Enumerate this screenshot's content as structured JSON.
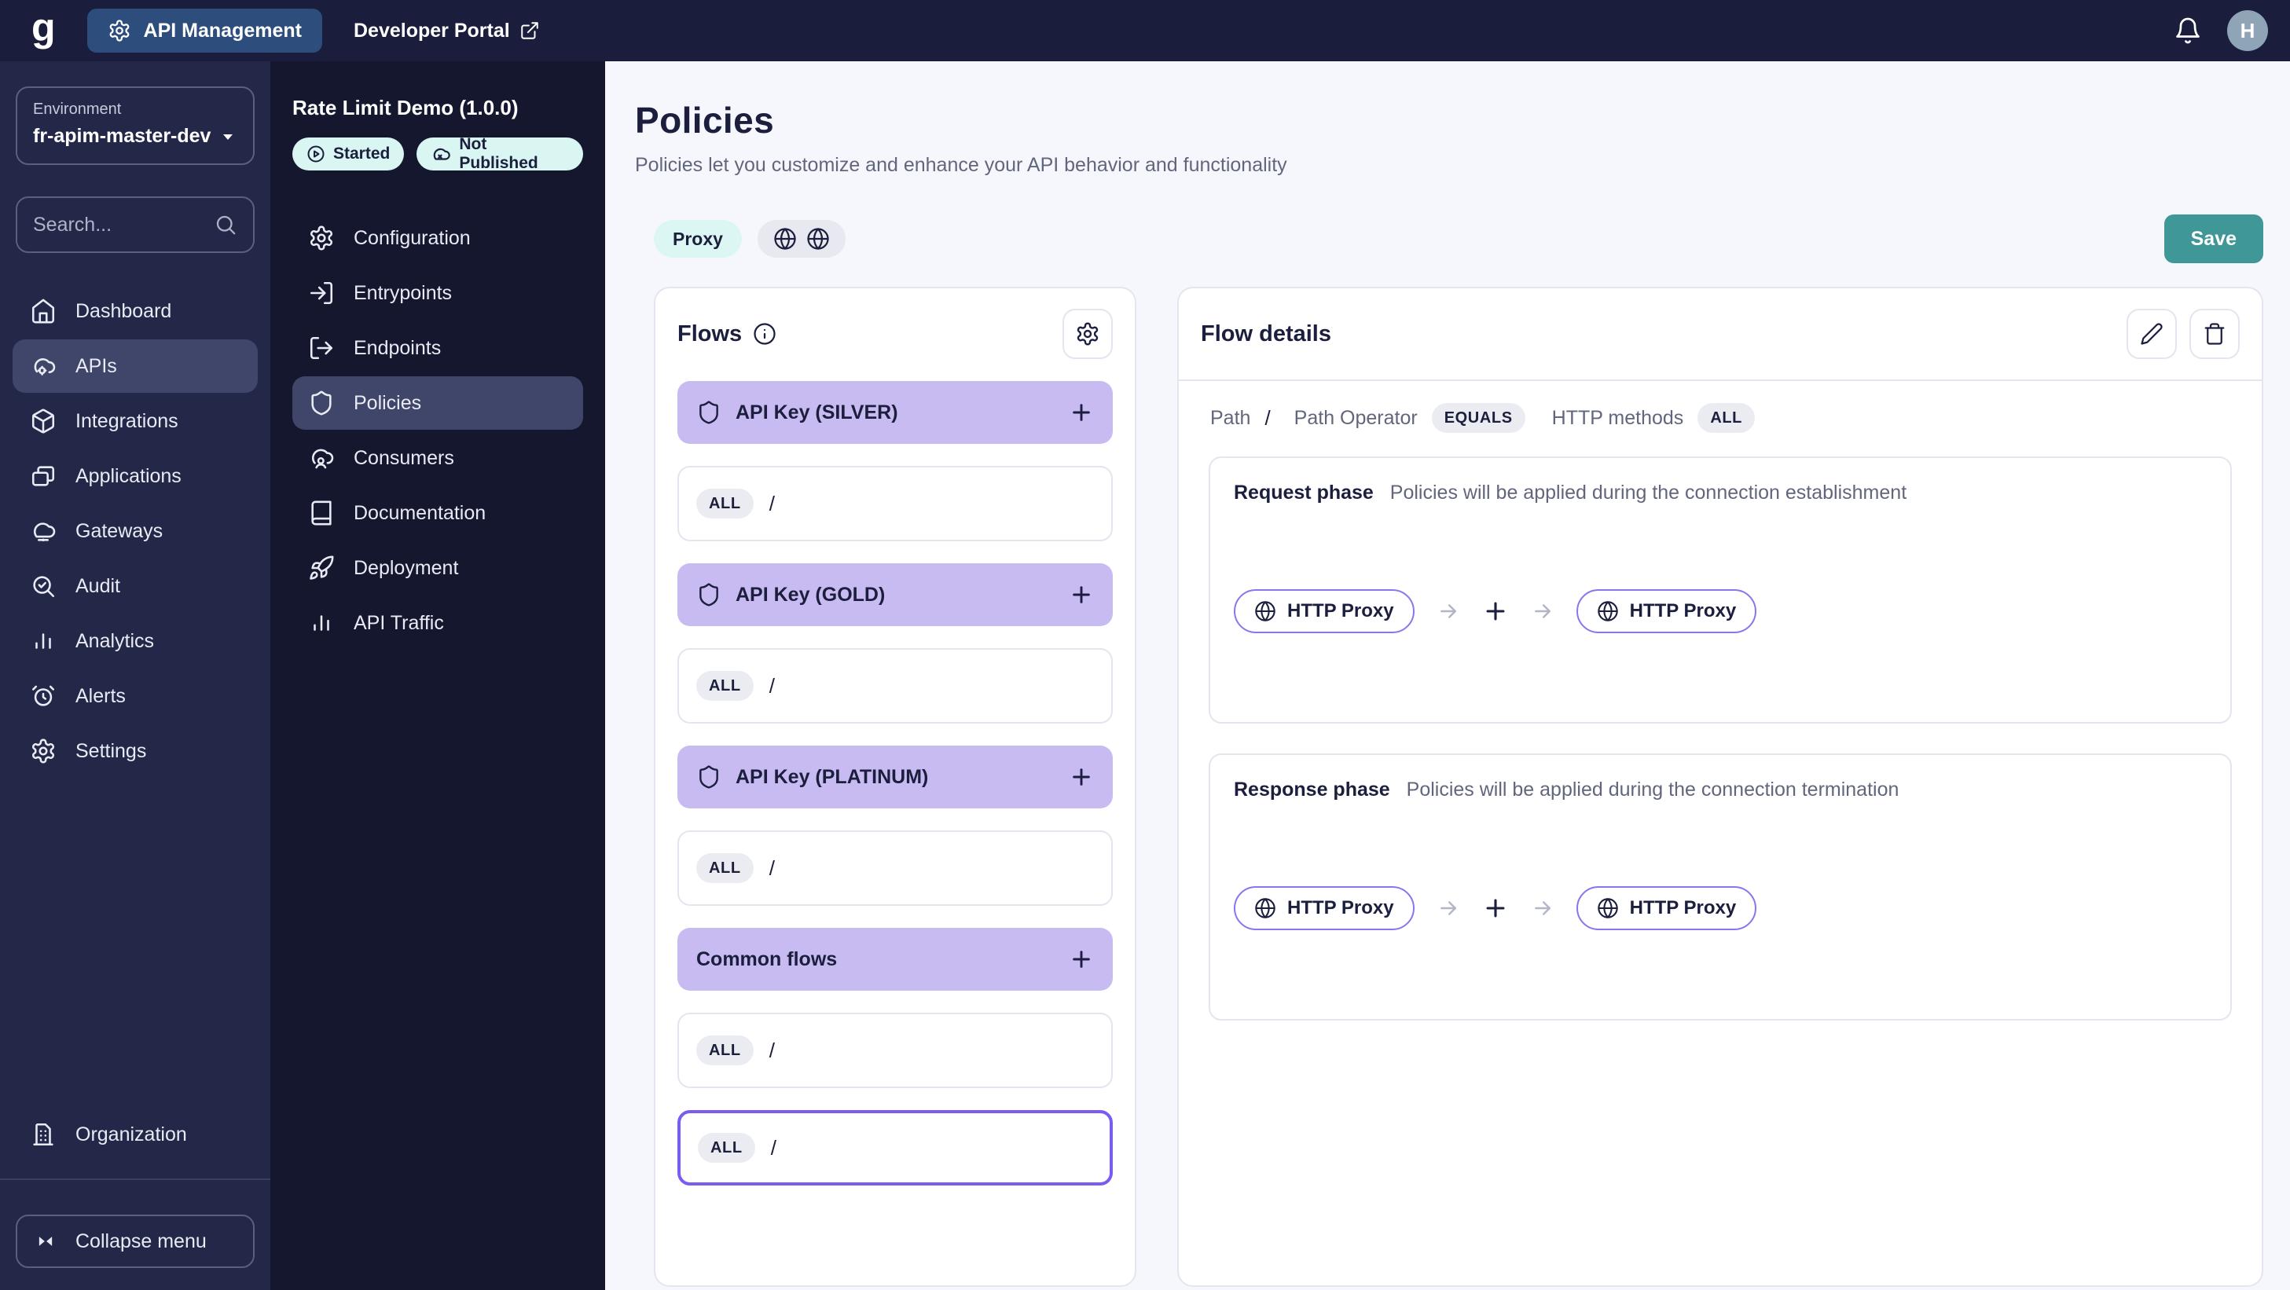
{
  "colors": {
    "accent_purple": "#7a5cf0",
    "group_header_purple": "#c7bbf2",
    "teal": "#3f9798",
    "badge_bg": "#d9f6f3",
    "navy": "#1a1e3c",
    "sidebar": "#232849",
    "subsidebar": "#14172e"
  },
  "topbar": {
    "logo": "g",
    "console_label": "API Management",
    "portal_label": "Developer Portal",
    "avatar_initial": "H"
  },
  "env_sidebar": {
    "environment_label": "Environment",
    "environment_value": "fr-apim-master-dev",
    "search_placeholder": "Search...",
    "items": [
      {
        "icon": "home-icon",
        "label": "Dashboard",
        "active": false
      },
      {
        "icon": "cloud-gear-icon",
        "label": "APIs",
        "active": true
      },
      {
        "icon": "cube-icon",
        "label": "Integrations",
        "active": false
      },
      {
        "icon": "windows-icon",
        "label": "Applications",
        "active": false
      },
      {
        "icon": "cloud-node-icon",
        "label": "Gateways",
        "active": false
      },
      {
        "icon": "search-check-icon",
        "label": "Audit",
        "active": false
      },
      {
        "icon": "bar-chart-icon",
        "label": "Analytics",
        "active": false
      },
      {
        "icon": "alarm-icon",
        "label": "Alerts",
        "active": false
      },
      {
        "icon": "gear-icon",
        "label": "Settings",
        "active": false
      }
    ],
    "organization_label": "Organization",
    "collapse_label": "Collapse menu"
  },
  "api_sidebar": {
    "api_title": "Rate Limit Demo (1.0.0)",
    "badges": [
      {
        "icon": "play-circle-icon",
        "label": "Started"
      },
      {
        "icon": "cloud-off-icon",
        "label": "Not Published"
      }
    ],
    "items": [
      {
        "icon": "gear-icon",
        "label": "Configuration",
        "active": false
      },
      {
        "icon": "log-in-icon",
        "label": "Entrypoints",
        "active": false
      },
      {
        "icon": "log-out-icon",
        "label": "Endpoints",
        "active": false
      },
      {
        "icon": "shield-icon",
        "label": "Policies",
        "active": true
      },
      {
        "icon": "user-cloud-icon",
        "label": "Consumers",
        "active": false
      },
      {
        "icon": "book-icon",
        "label": "Documentation",
        "active": false
      },
      {
        "icon": "rocket-icon",
        "label": "Deployment",
        "active": false
      },
      {
        "icon": "bar-chart-icon",
        "label": "API Traffic",
        "active": false
      }
    ]
  },
  "main": {
    "title": "Policies",
    "subtitle": "Policies let you customize and enhance your API behavior and functionality",
    "proxy_badge": "Proxy",
    "save_label": "Save",
    "flows": {
      "title": "Flows",
      "groups": [
        {
          "label": "API Key (SILVER)",
          "icon": "shield-icon"
        },
        {
          "label": "API Key (GOLD)",
          "icon": "shield-icon"
        },
        {
          "label": "API Key (PLATINUM)",
          "icon": "shield-icon"
        },
        {
          "label": "Common flows",
          "icon": null
        }
      ],
      "rows": [
        {
          "method": "ALL",
          "path": "/",
          "group": 0,
          "selected": false
        },
        {
          "method": "ALL",
          "path": "/",
          "group": 1,
          "selected": false
        },
        {
          "method": "ALL",
          "path": "/",
          "group": 2,
          "selected": false
        },
        {
          "method": "ALL",
          "path": "/",
          "group": 3,
          "selected": false
        },
        {
          "method": "ALL",
          "path": "/",
          "group": 3,
          "selected": true
        }
      ]
    },
    "flow_details": {
      "title": "Flow details",
      "path_label": "Path",
      "path_value": "/",
      "operator_label": "Path Operator",
      "operator_value": "EQUALS",
      "methods_label": "HTTP methods",
      "methods_value": "ALL",
      "phases": [
        {
          "name": "Request phase",
          "description": "Policies will be applied during the connection establishment",
          "chips": [
            "HTTP Proxy",
            "HTTP Proxy"
          ]
        },
        {
          "name": "Response phase",
          "description": "Policies will be applied during the connection termination",
          "chips": [
            "HTTP Proxy",
            "HTTP Proxy"
          ]
        }
      ]
    }
  }
}
